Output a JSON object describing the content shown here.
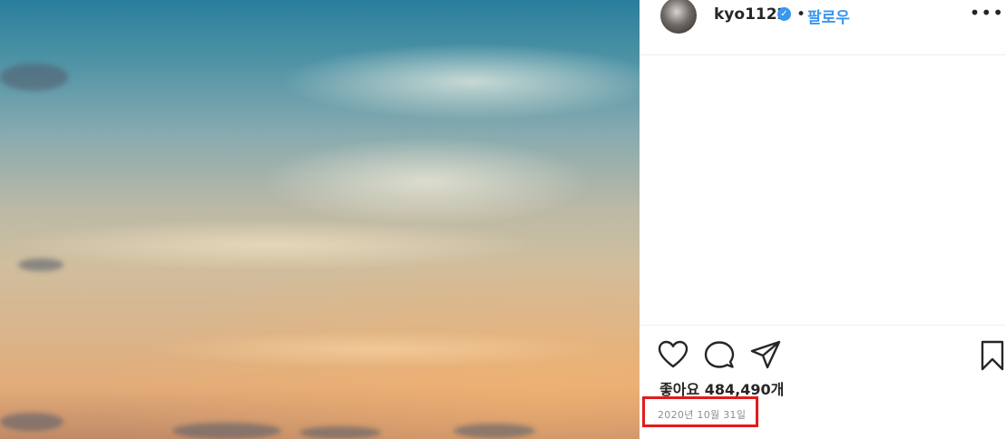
{
  "post": {
    "username": "kyo1122",
    "separator": "•",
    "follow_label": "팔로우",
    "more_label": "•••",
    "verified_icon": "verified-badge-icon",
    "likes_text": "좋아요 484,490개",
    "date": "2020년 10월 31일",
    "accent_color": "#3897f0",
    "highlight_color": "#e31b1b"
  },
  "actions": {
    "icons": [
      "heart-icon",
      "comment-icon",
      "share-icon",
      "bookmark-icon"
    ]
  }
}
